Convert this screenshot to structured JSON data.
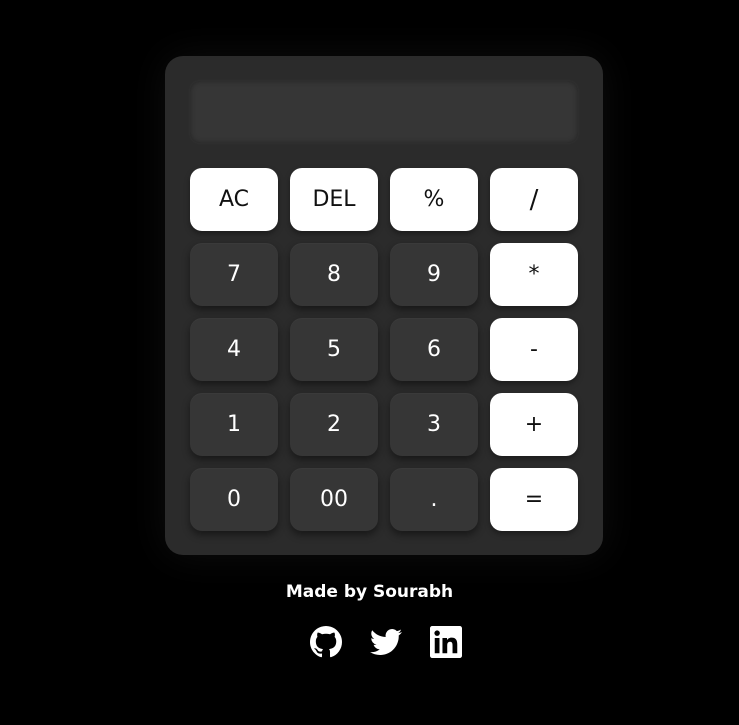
{
  "display": {
    "value": ""
  },
  "keys": {
    "ac": "AC",
    "del": "DEL",
    "percent": "%",
    "divide": "/",
    "seven": "7",
    "eight": "8",
    "nine": "9",
    "multiply": "*",
    "four": "4",
    "five": "5",
    "six": "6",
    "subtract": "-",
    "one": "1",
    "two": "2",
    "three": "3",
    "add": "+",
    "zero": "0",
    "double_zero": "00",
    "decimal": ".",
    "equals": "="
  },
  "footer": {
    "credit": "Made by Sourabh",
    "social": [
      "github-icon",
      "twitter-icon",
      "linkedin-icon"
    ]
  },
  "colors": {
    "page_bg": "#000000",
    "calculator_bg": "#2b2b2b",
    "dark_key": "#363636",
    "light_key": "#ffffff"
  }
}
